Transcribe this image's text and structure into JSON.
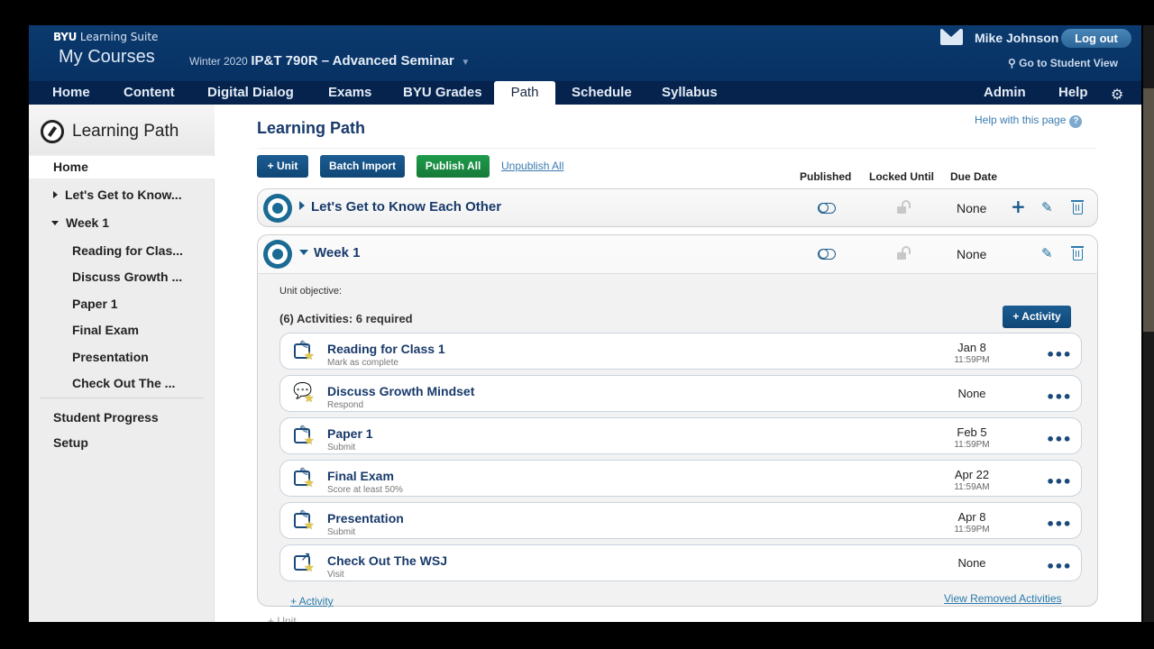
{
  "header": {
    "brand_bold": "BYU",
    "brand_rest": "Learning Suite",
    "my_courses": "My Courses",
    "term": "Winter 2020",
    "course_name": "IP&T 790R – Advanced Seminar",
    "user_name": "Mike Johnson",
    "logout_label": "Log out",
    "student_view_label": "Go to Student View"
  },
  "nav": {
    "items": [
      "Home",
      "Content",
      "Digital Dialog",
      "Exams",
      "BYU Grades",
      "Path",
      "Schedule",
      "Syllabus"
    ],
    "active": "Path",
    "right_items": [
      "Admin",
      "Help"
    ]
  },
  "sidebar": {
    "title": "Learning Path",
    "home": "Home",
    "units": [
      {
        "label": "Let's Get to Know...",
        "expanded": false
      },
      {
        "label": "Week 1",
        "expanded": true
      }
    ],
    "activities": [
      "Reading for Clas...",
      "Discuss Growth ...",
      "Paper 1",
      "Final Exam",
      "Presentation",
      "Check Out The ..."
    ],
    "footer_items": [
      "Student Progress",
      "Setup"
    ]
  },
  "main": {
    "title": "Learning Path",
    "help_link": "Help with this page",
    "buttons": {
      "add_unit": "+ Unit",
      "batch_import": "Batch Import",
      "publish_all": "Publish All",
      "unpublish_all": "Unpublish All"
    },
    "columns": {
      "published": "Published",
      "locked_until": "Locked Until",
      "due_date": "Due Date"
    },
    "units": [
      {
        "name": "Let's Get to Know Each Other",
        "due": "None",
        "published": false,
        "expanded": false
      },
      {
        "name": "Week 1",
        "due": "None",
        "published": false,
        "expanded": true
      }
    ],
    "week1": {
      "objective_label": "Unit objective:",
      "activities_count": "(6) Activities: 6 required",
      "add_activity_button": "+ Activity",
      "add_activity_link": "+ Activity",
      "view_removed": "View Removed Activities",
      "activities": [
        {
          "name": "Reading for Class 1",
          "sub": "Mark as complete",
          "date": "Jan 8",
          "time": "11:59PM",
          "icon": "edit-icon"
        },
        {
          "name": "Discuss Growth Mindset",
          "sub": "Respond",
          "date": "None",
          "time": "",
          "icon": "discussion-icon"
        },
        {
          "name": "Paper 1",
          "sub": "Submit",
          "date": "Feb 5",
          "time": "11:59PM",
          "icon": "edit-icon"
        },
        {
          "name": "Final Exam",
          "sub": "Score at least 50%",
          "date": "Apr 22",
          "time": "11:59AM",
          "icon": "edit-icon"
        },
        {
          "name": "Presentation",
          "sub": "Submit",
          "date": "Apr 8",
          "time": "11:59PM",
          "icon": "edit-icon"
        },
        {
          "name": "Check Out The WSJ",
          "sub": "Visit",
          "date": "None",
          "time": "",
          "icon": "external-link-icon"
        }
      ]
    },
    "add_unit_link": "+ Unit"
  }
}
